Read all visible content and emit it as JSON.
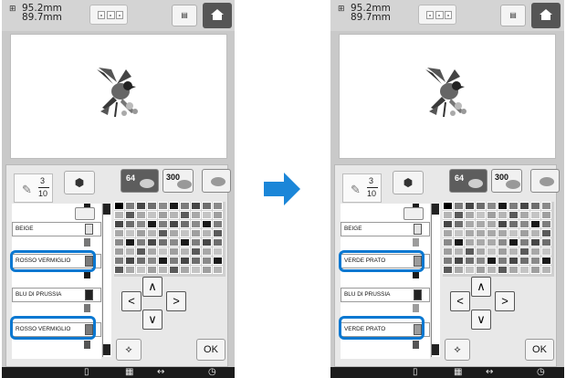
{
  "size": {
    "width": "95.2mm",
    "height": "89.7mm"
  },
  "stitch_counter": {
    "current": "3",
    "total": "10"
  },
  "tabs": {
    "palette64": "64",
    "palette300": "300"
  },
  "ok_label": "OK",
  "icons": {
    "size": "frame-size-icon",
    "frame": "frame-selector-icon",
    "memory": "memory-icon",
    "home": "home-icon",
    "pen": "pen-icon",
    "cube": "cube-icon",
    "sort": "sort-icon",
    "magic": "magic-wand-icon",
    "up": "arrow-up-icon",
    "down": "arrow-down-icon",
    "left": "arrow-left-icon",
    "right": "arrow-right-icon",
    "page": "page-icon",
    "grid": "grid-icon",
    "needle": "needle-icon",
    "clock": "clock-icon"
  },
  "screens": [
    {
      "id": "before",
      "thread_list": [
        {
          "label": "BEIGE",
          "swatch": "#e2e2e2",
          "highlight": false
        },
        {
          "label": "ROSSO VERMIGLIO",
          "swatch": "#7a7a7a",
          "highlight": true
        },
        {
          "label": "BLU DI PRUSSIA",
          "swatch": "#222222",
          "highlight": false
        },
        {
          "label": "ROSSO VERMIGLIO",
          "swatch": "#7a7a7a",
          "highlight": true
        }
      ]
    },
    {
      "id": "after",
      "thread_list": [
        {
          "label": "BEIGE",
          "swatch": "#e2e2e2",
          "highlight": false
        },
        {
          "label": "VERDE PRATO",
          "swatch": "#9c9c9c",
          "highlight": true
        },
        {
          "label": "BLU DI PRUSSIA",
          "swatch": "#222222",
          "highlight": false
        },
        {
          "label": "VERDE PRATO",
          "swatch": "#9c9c9c",
          "highlight": true
        }
      ]
    }
  ],
  "colors": {
    "highlight": "#0a78d1",
    "transition_arrow": "#1b86d8",
    "header_dark": "#555555"
  }
}
